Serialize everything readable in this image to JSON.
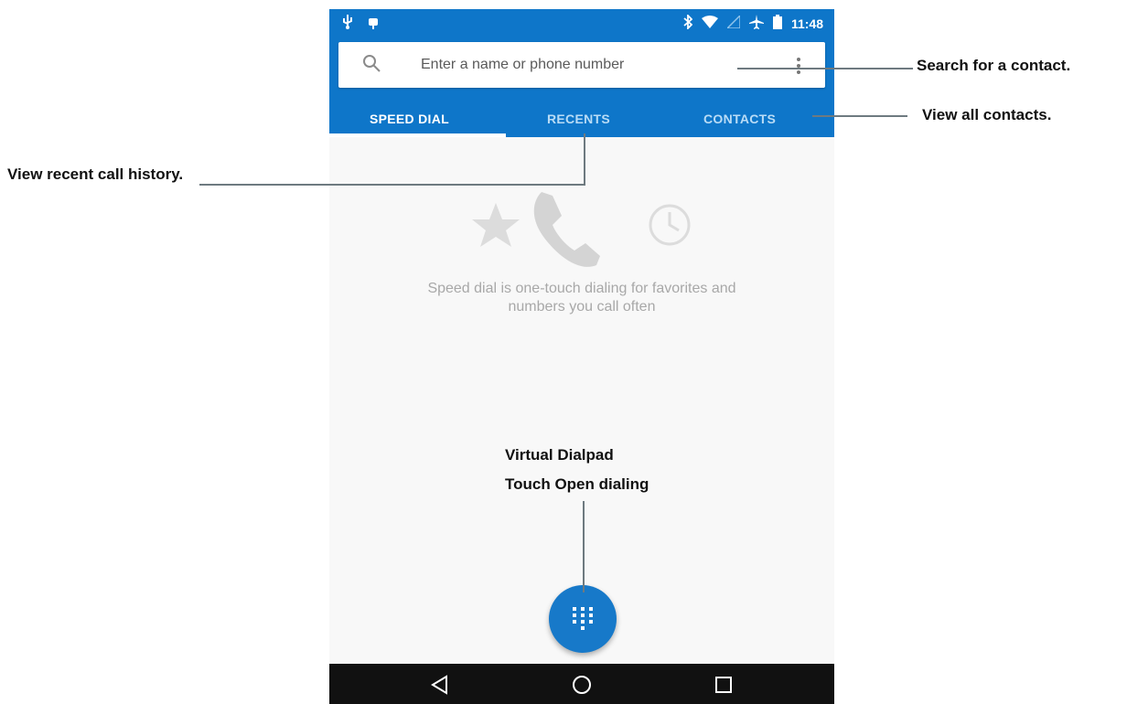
{
  "status_bar": {
    "left_icons": [
      "usb-icon",
      "android-icon"
    ],
    "right_icons": [
      "bluetooth-icon",
      "wifi-icon",
      "no-signal-icon",
      "airplane-icon",
      "battery-icon"
    ],
    "time": "11:48"
  },
  "search": {
    "placeholder": "Enter a name or phone number",
    "value": ""
  },
  "tabs": [
    {
      "label": "SPEED DIAL",
      "active": true
    },
    {
      "label": "RECENTS",
      "active": false
    },
    {
      "label": "CONTACTS",
      "active": false
    }
  ],
  "empty_state": {
    "icons": [
      "star-icon",
      "phone-icon",
      "clock-icon"
    ],
    "line1": "Speed dial is one-touch dialing for favorites and",
    "line2": "numbers you call often"
  },
  "fab": {
    "icon": "dialpad-icon"
  },
  "nav_bar": {
    "icons": [
      "back-icon",
      "home-icon",
      "recents-icon"
    ]
  },
  "annotations": {
    "search": "Search for a contact.",
    "contacts": "View all contacts.",
    "recents": "View recent call history.",
    "dialpad_line1": "Virtual Dialpad",
    "dialpad_line2": "Touch Open dialing"
  },
  "colors": {
    "primary": "#0e76c9",
    "fab": "#1779c9",
    "background": "#f8f8f8",
    "nav_bar": "#111111"
  }
}
